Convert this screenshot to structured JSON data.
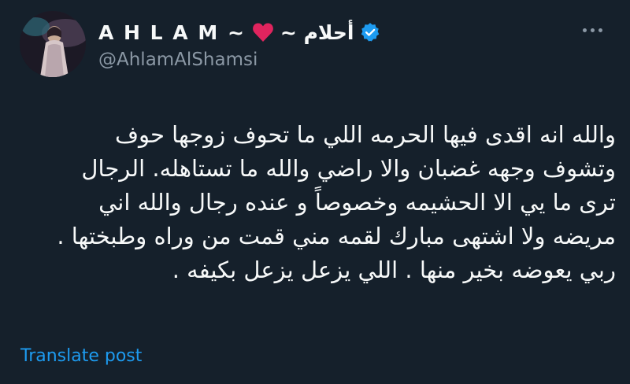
{
  "author": {
    "name_latin": "A H L A M ~",
    "name_arabic": "~ أحلام",
    "handle": "@AhlamAlShamsi",
    "verified": true
  },
  "colors": {
    "background": "#15202b",
    "text": "#f7f9f9",
    "secondary": "#8b98a5",
    "link": "#1d9bf0",
    "verified": "#1d9bf0",
    "heart": "#e0245e"
  },
  "icons": {
    "heart": "heart-icon",
    "verified": "verified-badge-icon",
    "more": "more-options-icon"
  },
  "tweet": {
    "lines": [
      "والله انه اقدى فيها  الحرمه اللي ما تحوف زوجها حوف",
      "وتشوف وجهه غضبان والا راضي والله ما تستاهله.  الرجال",
      "ترى ما يي الا الحشيمه وخصوصاً و عنده رجال والله اني",
      "مريضه ولا اشتهى مبارك لقمه مني قمت من وراه وطبختها .",
      "ربي يعوضه بخير منها . اللي يزعل يزعل بكيفه ."
    ]
  },
  "actions": {
    "translate": "Translate post"
  }
}
